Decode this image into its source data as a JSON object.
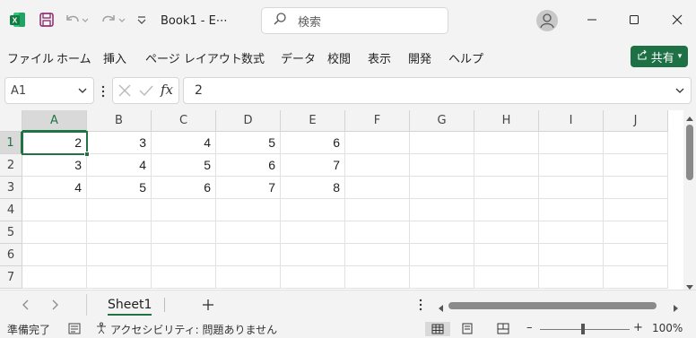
{
  "titlebar": {
    "title": "Book1  -  E⋯",
    "search_placeholder": "検索"
  },
  "ribbon": {
    "tabs": [
      "ファイル",
      "ホーム",
      "挿入",
      "ページ レイアウト",
      "数式",
      "データ",
      "校閲",
      "表示",
      "開発",
      "ヘルプ"
    ],
    "share_label": "共有"
  },
  "formula_bar": {
    "name_box": "A1",
    "fx_label": "fx",
    "value": "2"
  },
  "grid": {
    "columns": [
      "A",
      "B",
      "C",
      "D",
      "E",
      "F",
      "G",
      "H",
      "I",
      "J"
    ],
    "rows": [
      "1",
      "2",
      "3",
      "4",
      "5",
      "6",
      "7"
    ],
    "cells": [
      [
        "2",
        "3",
        "4",
        "5",
        "6",
        "",
        "",
        "",
        "",
        ""
      ],
      [
        "3",
        "4",
        "5",
        "6",
        "7",
        "",
        "",
        "",
        "",
        ""
      ],
      [
        "4",
        "5",
        "6",
        "7",
        "8",
        "",
        "",
        "",
        "",
        ""
      ],
      [
        "",
        "",
        "",
        "",
        "",
        "",
        "",
        "",
        "",
        ""
      ],
      [
        "",
        "",
        "",
        "",
        "",
        "",
        "",
        "",
        "",
        ""
      ],
      [
        "",
        "",
        "",
        "",
        "",
        "",
        "",
        "",
        "",
        ""
      ],
      [
        "",
        "",
        "",
        "",
        "",
        "",
        "",
        "",
        "",
        ""
      ]
    ],
    "active_cell": "A1"
  },
  "sheets": {
    "tabs": [
      "Sheet1"
    ],
    "active": "Sheet1"
  },
  "statusbar": {
    "ready": "準備完了",
    "accessibility": "アクセシビリティ: 問題ありません",
    "zoom": "100%",
    "zoom_minus": "–",
    "zoom_plus": "+"
  },
  "colors": {
    "accent": "#217346",
    "share_button": "#1e7145"
  },
  "icons": [
    "excel-logo-icon",
    "save-icon",
    "undo-icon",
    "redo-icon",
    "customize-qat-icon",
    "search-icon",
    "user-icon",
    "minimize-icon",
    "maximize-icon",
    "close-icon",
    "share-icon",
    "cancel-icon",
    "enter-icon",
    "fx-icon",
    "add-sheet-icon",
    "normal-view-icon",
    "page-layout-icon",
    "page-break-icon"
  ]
}
